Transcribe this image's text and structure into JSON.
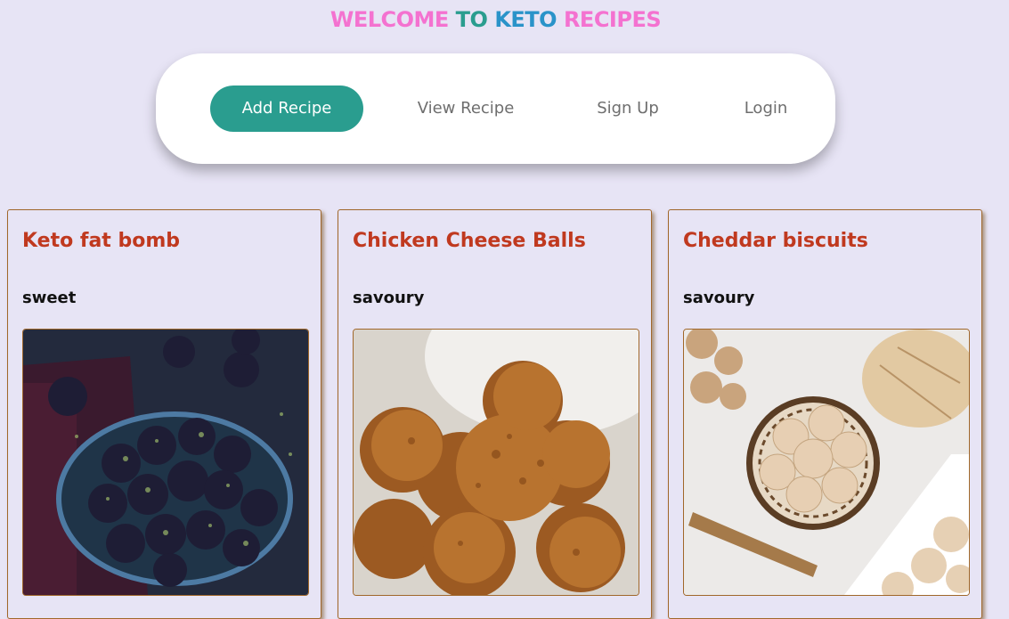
{
  "header": {
    "word1": "WELCOME",
    "word2": "TO",
    "word3": "KETO",
    "word4": "RECIPES"
  },
  "nav": {
    "add_recipe": "Add Recipe",
    "view_recipe": "View Recipe",
    "sign_up": "Sign Up",
    "login": "Login"
  },
  "recipes": [
    {
      "title": "Keto fat bomb",
      "category": "sweet"
    },
    {
      "title": "Chicken Cheese Balls",
      "category": "savoury"
    },
    {
      "title": "Cheddar biscuits",
      "category": "savoury"
    }
  ],
  "colors": {
    "background": "#e7e4f5",
    "accent": "#2a9d8f",
    "title_red": "#c0391f",
    "pink": "#f472d0",
    "blue": "#2a93c9"
  }
}
